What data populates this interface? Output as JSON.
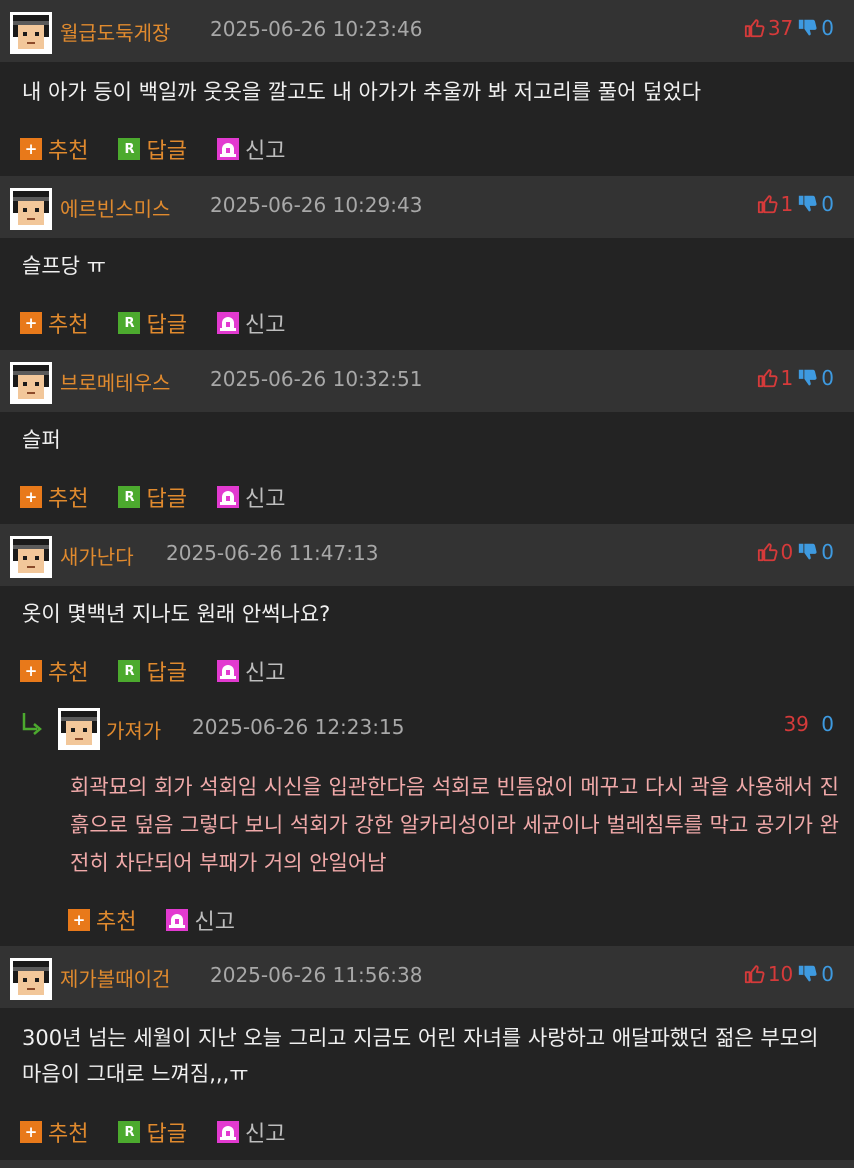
{
  "comments": [
    {
      "author": "월급도둑게장",
      "date": "2025-06-26 10:23:46",
      "up": "37",
      "down": "0",
      "text": "내 아가 등이 백일까 웃옷을 깔고도 내 아가가 추울까 봐 저고리를 풀어 덮었다"
    },
    {
      "author": "에르빈스미스",
      "date": "2025-06-26 10:29:43",
      "up": "1",
      "down": "0",
      "text": "슬프당 ㅠ"
    },
    {
      "author": "브로메테우스",
      "date": "2025-06-26 10:32:51",
      "up": "1",
      "down": "0",
      "text": "슬퍼"
    },
    {
      "author": "새가난다",
      "date": "2025-06-26 11:47:13",
      "up": "0",
      "down": "0",
      "text": "옷이 몇백년 지나도 원래 안썩나요?"
    },
    {
      "author": "제가볼때이건",
      "date": "2025-06-26 11:56:38",
      "up": "10",
      "down": "0",
      "text": "300년 넘는 세월이 지난 오늘 그리고 지금도 어린 자녀를 사랑하고 애달파했던 젊은 부모의 마음이 그대로 느껴짐,,,ㅠ"
    }
  ],
  "reply": {
    "author": "가져가",
    "date": "2025-06-26 12:23:15",
    "up": "39",
    "down": "0",
    "text": "회곽묘의 회가 석회임 시신을 입관한다음 석회로 빈틈없이 메꾸고 다시 곽을 사용해서 진흙으로 덮음 그렇다 보니 석회가 강한 알카리성이라 세균이나 벌레침투를 막고 공기가 완전히 차단되어 부패가 거의 안일어남"
  },
  "actions": {
    "recommend": "추천",
    "reply": "답글",
    "report": "신고",
    "reply_icon_letter": "R"
  },
  "colors": {
    "author": "#e08a2e",
    "upvote": "#d53a3a",
    "downvote": "#3e9ae0",
    "reply_text": "#f0a9a9"
  },
  "icons": {
    "avatar": "pixel-face-avatar",
    "up": "thumbs-up-icon",
    "down": "thumbs-down-icon",
    "recommend": "plus-icon",
    "reply": "reply-icon",
    "report": "siren-icon",
    "reply_arrow": "reply-arrow-icon"
  }
}
